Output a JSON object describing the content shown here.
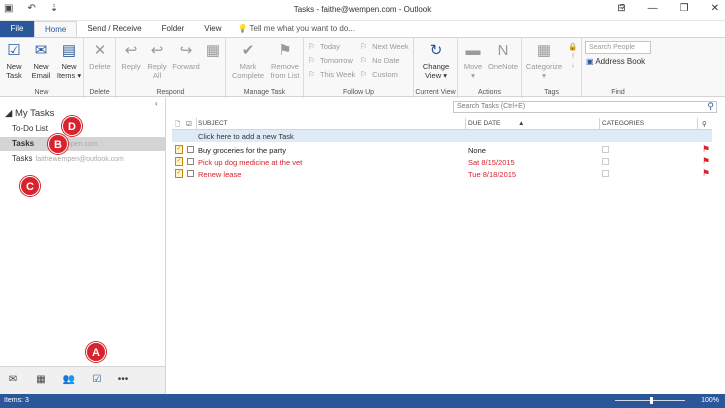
{
  "window": {
    "title": "Tasks - faithe@wempen.com - Outlook",
    "help": "?",
    "minimize": "—",
    "restore": "❐",
    "close": "✕"
  },
  "tabs": [
    "File",
    "Home",
    "Send / Receive",
    "Folder",
    "View"
  ],
  "tell_me": "Tell me what you want to do...",
  "ribbon": {
    "new": {
      "label": "New",
      "new_task": "New\nTask",
      "new_email": "New\nEmail",
      "new_items": "New\nItems"
    },
    "delete": {
      "label": "Delete",
      "delete": "Delete"
    },
    "respond": {
      "label": "Respond",
      "reply": "Reply",
      "reply_all": "Reply\nAll",
      "forward": "Forward"
    },
    "manage_task": {
      "label": "Manage Task",
      "mark_complete": "Mark\nComplete",
      "remove_from_list": "Remove\nfrom List"
    },
    "follow_up": {
      "label": "Follow Up",
      "today": "Today",
      "tomorrow": "Tomorrow",
      "this_week": "This Week",
      "next_week": "Next Week",
      "no_date": "No Date",
      "custom": "Custom"
    },
    "current_view": {
      "label": "Current View",
      "change_view": "Change\nView"
    },
    "actions": {
      "label": "Actions",
      "move": "Move",
      "onenote": "OneNote"
    },
    "tags": {
      "label": "Tags",
      "categorize": "Categorize"
    },
    "find": {
      "label": "Find",
      "search_people": "Search People",
      "address_book": "Address Book"
    }
  },
  "nav": {
    "header": "My Tasks",
    "items": [
      {
        "label": "To-Do List",
        "account": ""
      },
      {
        "label": "Tasks",
        "account": "wempen.com"
      },
      {
        "label": "Tasks",
        "account": "faithewempen@outlook.com"
      }
    ]
  },
  "callouts": [
    "A",
    "B",
    "C",
    "D"
  ],
  "main": {
    "search_placeholder": "Search Tasks (Ctrl+E)",
    "columns": {
      "subject": "SUBJECT",
      "due": "DUE DATE",
      "categories": "CATEGORIES"
    },
    "add_new": "Click here to add a new Task",
    "tasks": [
      {
        "subject": "Buy groceries for the party",
        "due": "None",
        "overdue": false
      },
      {
        "subject": "Pick up dog medicine at the vet",
        "due": "Sat 8/15/2015",
        "overdue": true
      },
      {
        "subject": "Renew lease",
        "due": "Tue 8/18/2015",
        "overdue": true
      }
    ]
  },
  "status": {
    "items": "Items: 3",
    "zoom": "100%"
  }
}
